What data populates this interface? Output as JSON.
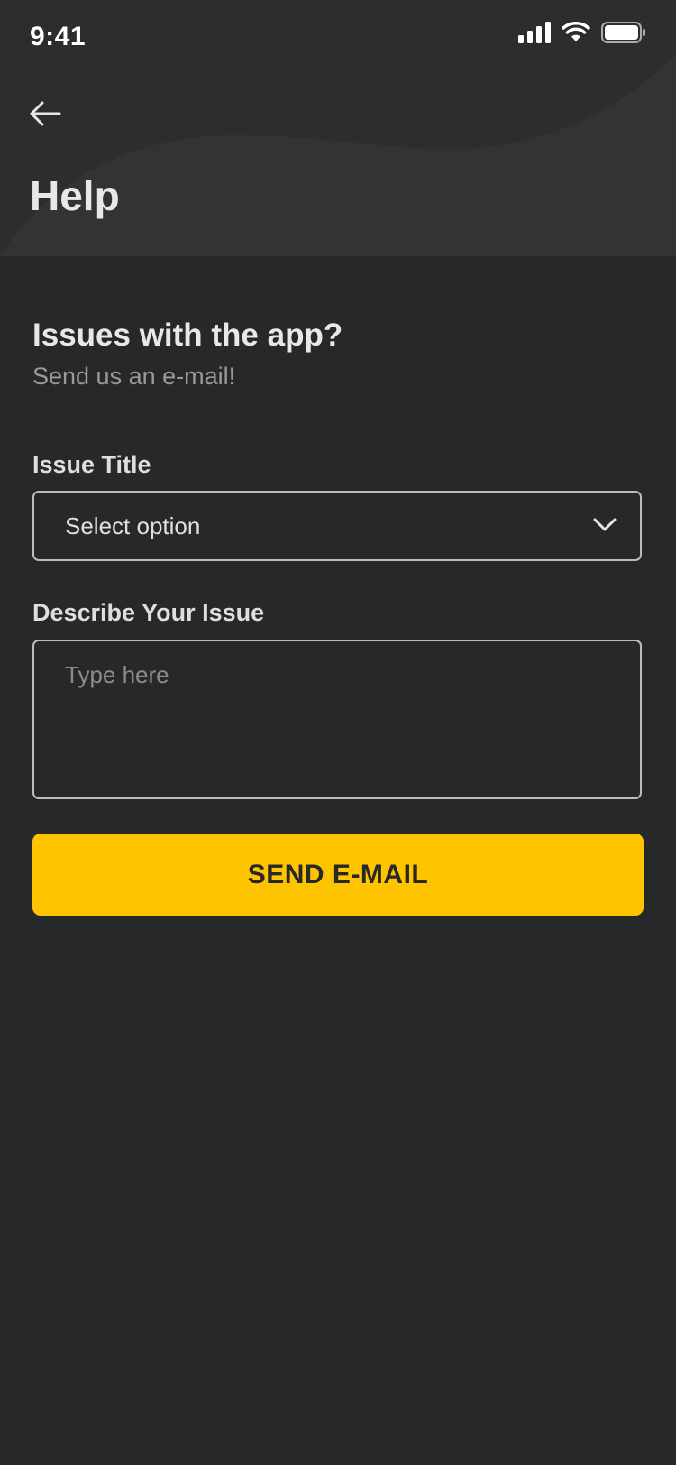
{
  "status_bar": {
    "time": "9:41",
    "icons": [
      "signal-icon",
      "wifi-icon",
      "battery-icon"
    ]
  },
  "header": {
    "back_icon": "arrow-left-icon",
    "title": "Help"
  },
  "intro": {
    "heading": "Issues with the app?",
    "subheading": "Send us an e-mail!"
  },
  "form": {
    "issue_title": {
      "label": "Issue Title",
      "selected_value": "Select option",
      "icon": "chevron-down-icon"
    },
    "description": {
      "label": "Describe Your Issue",
      "placeholder": "Type here",
      "value": ""
    },
    "submit_label": "SEND E-MAIL"
  },
  "colors": {
    "background": "#27282a",
    "header_background": "#2d2d2e",
    "accent": "#ffc400",
    "border": "#bdbdbd",
    "muted_text": "#9a9a9a"
  }
}
